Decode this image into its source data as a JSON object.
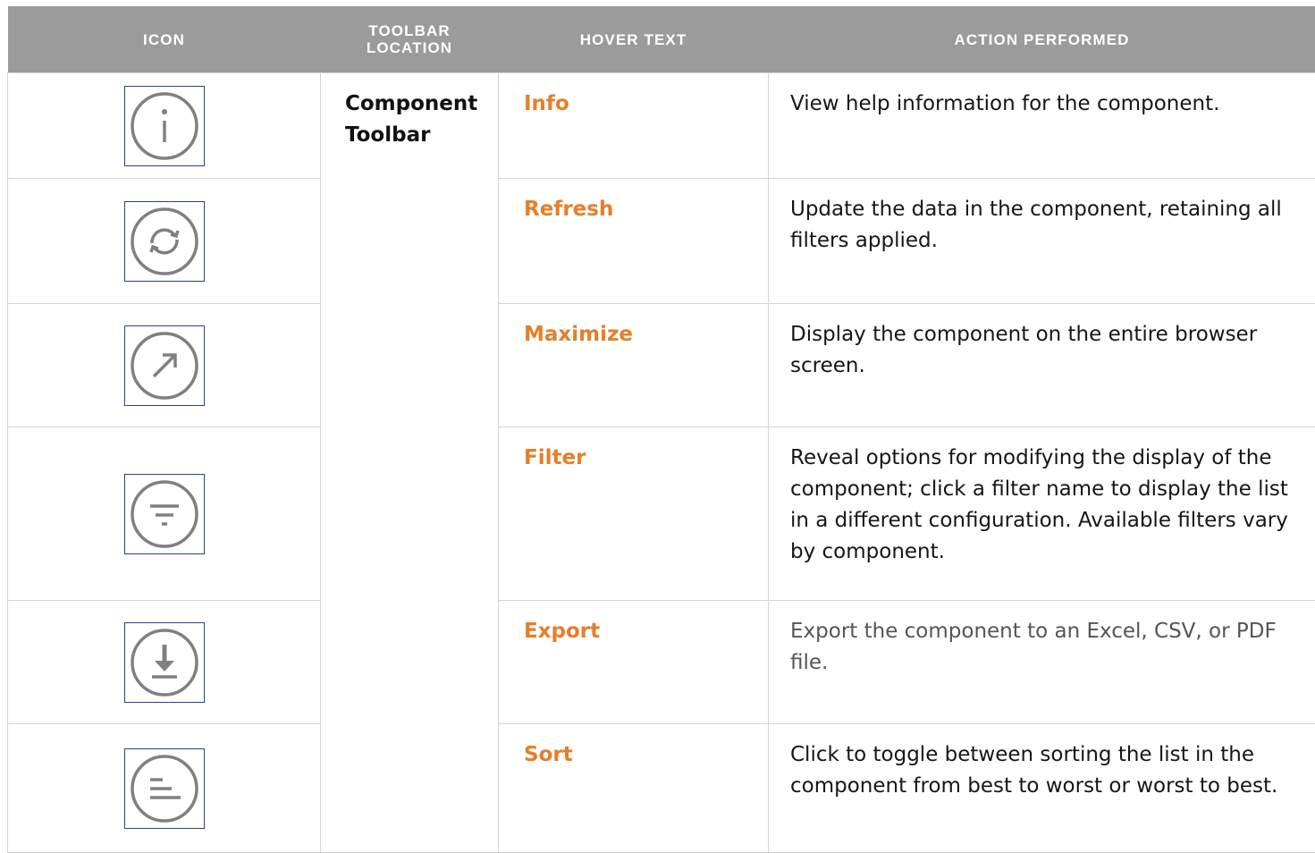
{
  "header": {
    "col_icon": "ICON",
    "col_location": "TOOLBAR LOCATION",
    "col_hover": "HOVER TEXT",
    "col_action": "ACTION PERFORMED"
  },
  "location": "Component Toolbar",
  "rows": [
    {
      "icon": "info-icon",
      "hover": "Info",
      "action": "View help information for the component."
    },
    {
      "icon": "refresh-icon",
      "hover": "Refresh",
      "action": "Update the data in the component, retaining all filters applied."
    },
    {
      "icon": "maximize-icon",
      "hover": "Maximize",
      "action": "Display the component on the entire browser screen."
    },
    {
      "icon": "filter-icon",
      "hover": "Filter",
      "action": "Reveal options for modifying the display of the component; click a filter name to display the list in a different configuration. Available filters vary by component."
    },
    {
      "icon": "export-icon",
      "hover": "Export",
      "action": "Export the component to an Excel, CSV, or PDF file."
    },
    {
      "icon": "sort-icon",
      "hover": "Sort",
      "action": "Click to toggle between sorting the list in the component from best to worst or worst to best."
    }
  ],
  "colors": {
    "header_bg": "#9b9b9b",
    "hover_text": "#e67e2a",
    "icon_border": "#2c3f8f",
    "icon_stroke": "#808080"
  }
}
